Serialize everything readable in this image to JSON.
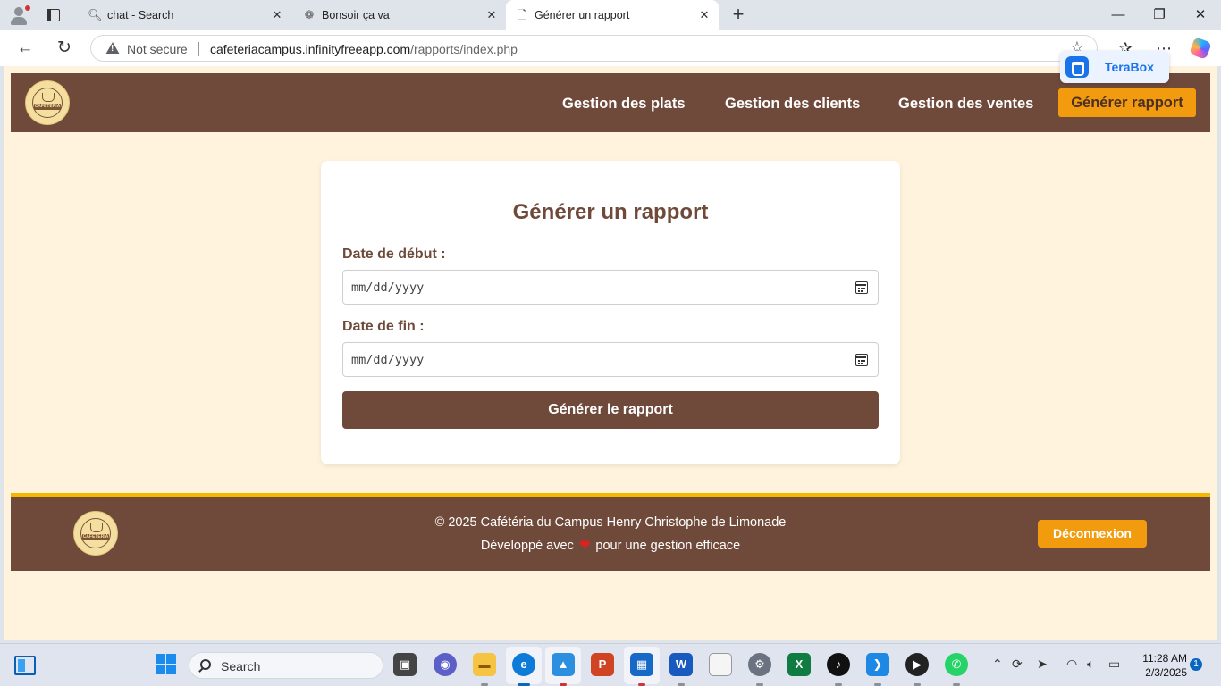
{
  "browser": {
    "tabs": [
      {
        "label": "chat - Search",
        "icon": "search-icon"
      },
      {
        "label": "Bonsoir ça va",
        "icon": "openai-icon"
      },
      {
        "label": "Générer un rapport",
        "icon": "page-icon",
        "active": true
      }
    ],
    "security_label": "Not secure",
    "url_host": "cafeteriacampus.infinityfreeapp.com",
    "url_path": "/rapports/index.php",
    "extension": {
      "name": "TeraBox"
    }
  },
  "site": {
    "logo_text": "CAFÉTÉRIA",
    "nav": {
      "plats": "Gestion des plats",
      "clients": "Gestion des clients",
      "ventes": "Gestion des ventes",
      "rapport": "Générer rapport"
    },
    "form": {
      "title": "Générer un rapport",
      "start_label": "Date de début :",
      "start_placeholder": "mm/dd/yyyy",
      "end_label": "Date de fin :",
      "end_placeholder": "mm/dd/yyyy",
      "submit_label": "Générer le rapport"
    },
    "footer": {
      "copyright": "© 2025 Cafétéria du Campus Henry Christophe de Limonade",
      "dev_before": "Développé avec",
      "dev_after": "pour une gestion efficace",
      "logout_label": "Déconnexion"
    }
  },
  "colors": {
    "brand_brown": "#6f4a3a",
    "accent_orange": "#f29b0e",
    "footer_border": "#f5b800",
    "page_bg": "#fff3dd"
  },
  "taskbar": {
    "search_label": "Search",
    "time": "11:28 AM",
    "date": "2/3/2025",
    "notification_count": "1"
  }
}
